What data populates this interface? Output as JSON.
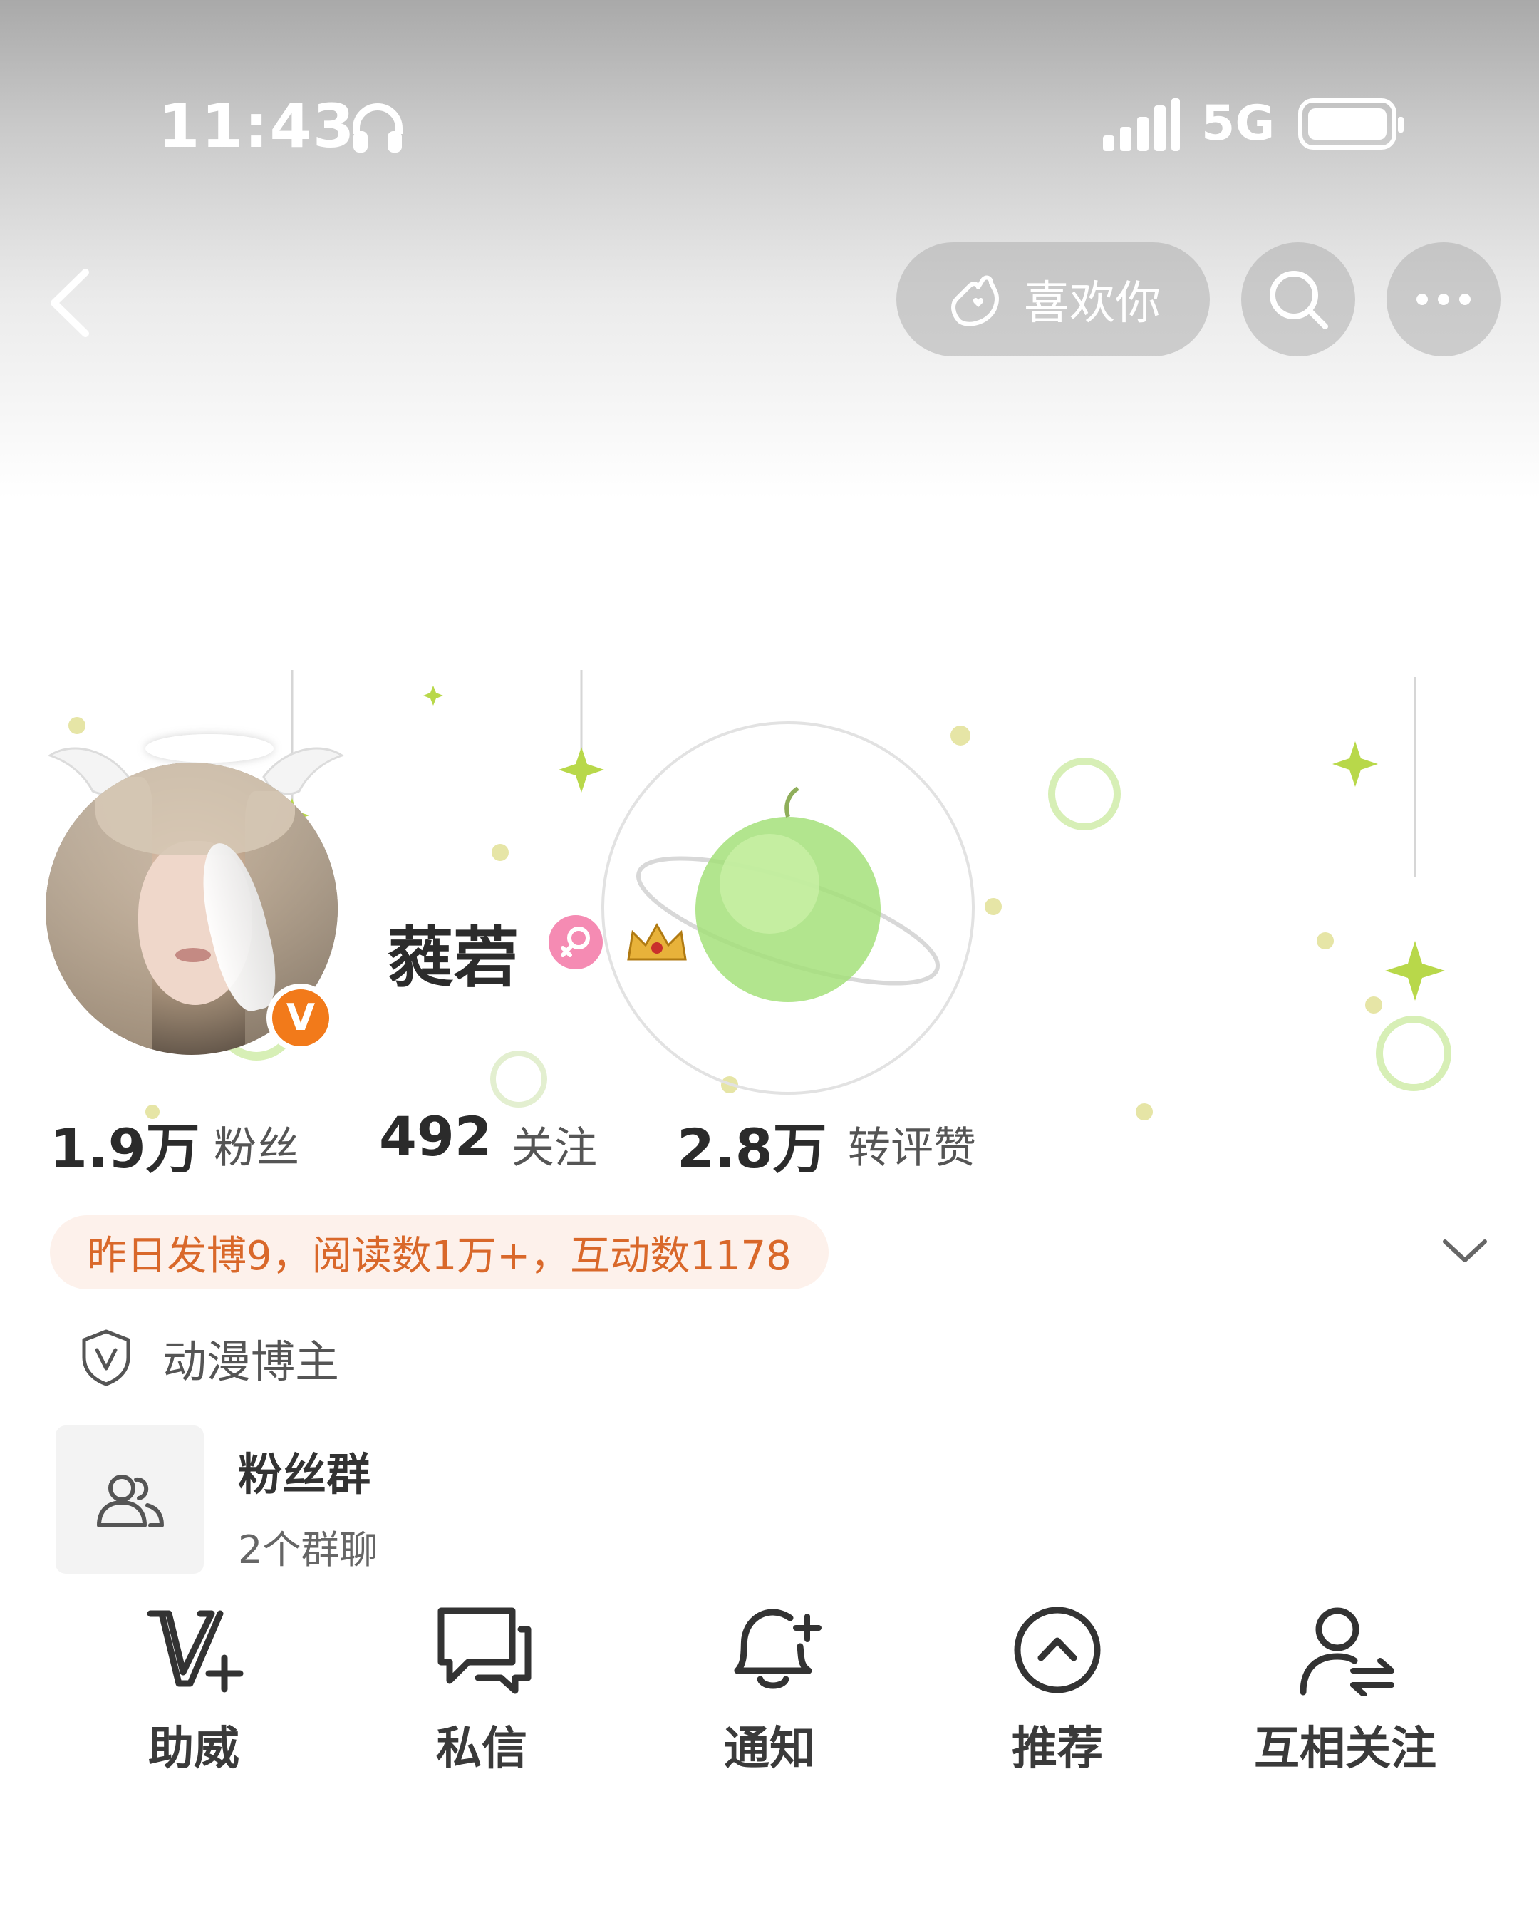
{
  "status_bar": {
    "time": "11:43",
    "network": "5G",
    "icons": [
      "headphone-icon",
      "signal-icon",
      "battery-icon"
    ]
  },
  "nav": {
    "back_icon": "chevron-left-icon",
    "like_button_label": "喜欢你",
    "like_icon": "hand-heart-icon",
    "search_icon": "search-icon",
    "more_icon": "more-dots-icon"
  },
  "profile": {
    "username": "蕤菪",
    "verify_badge": "V",
    "gender_icon": "female-icon",
    "accent": "#f27a1a"
  },
  "stats": [
    {
      "value": "1.9万",
      "label": "粉丝"
    },
    {
      "value": "492",
      "label": "关注"
    },
    {
      "value": "2.8万",
      "label": "转评赞"
    }
  ],
  "yesterday_summary": "昨日发博9，阅读数1万+，互动数1178",
  "category": {
    "label": "动漫博主",
    "icon": "shield-v-icon"
  },
  "fan_group": {
    "title": "粉丝群",
    "subtitle": "2个群聊",
    "icon": "group-icon"
  },
  "actions": [
    {
      "label": "助威",
      "icon": "v-plus-icon"
    },
    {
      "label": "私信",
      "icon": "chat-icon"
    },
    {
      "label": "通知",
      "icon": "bell-plus-icon"
    },
    {
      "label": "推荐",
      "icon": "chevron-up-circle-icon"
    },
    {
      "label": "互相关注",
      "icon": "user-exchange-icon"
    }
  ],
  "colors": {
    "banner_text": "#d9682a",
    "banner_bg": "#fdf1eb",
    "gender_badge": "#f58bb3",
    "deco_green": "#b8d84a"
  }
}
